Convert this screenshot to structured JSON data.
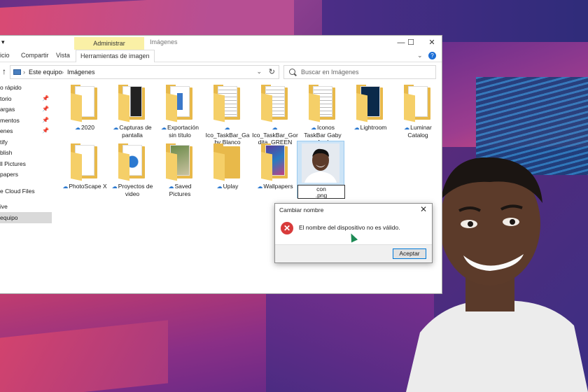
{
  "window": {
    "context_tab": "Administrar",
    "title": "Imágenes",
    "qa_arrow": "▾",
    "controls": [
      "—",
      "☐",
      "✕"
    ]
  },
  "ribbon": {
    "tabs": [
      "icio",
      "Compartir",
      "Vista",
      "Herramientas de imagen"
    ],
    "active_tab": "Herramientas de imagen",
    "expand": "⌄",
    "help": "?"
  },
  "address": {
    "up": "↑",
    "crumbs": [
      "Este equipo",
      "Imágenes"
    ],
    "separator": "›",
    "dropdown": "⌄",
    "refresh": "↻"
  },
  "search": {
    "placeholder": "Buscar en Imágenes",
    "icon": "search-icon"
  },
  "sidebar": {
    "items": [
      {
        "label": "o rápido",
        "pinned": false
      },
      {
        "label": "torio",
        "pinned": true
      },
      {
        "label": "argas",
        "pinned": true
      },
      {
        "label": "mentos",
        "pinned": true
      },
      {
        "label": "enes",
        "pinned": true
      },
      {
        "label": "tify",
        "pinned": false
      },
      {
        "label": "blish",
        "pinned": false
      },
      {
        "label": "ll Pictures",
        "pinned": false
      },
      {
        "label": "papers",
        "pinned": false
      },
      {
        "label": "e Cloud Files",
        "pinned": false
      },
      {
        "label": "ive",
        "pinned": false
      },
      {
        "label": "equipo",
        "pinned": false,
        "selected": true
      }
    ],
    "pin_glyph": "📌"
  },
  "files": [
    {
      "label": "2020",
      "content": "blank"
    },
    {
      "label": "Capturas de pantalla",
      "content": "dark"
    },
    {
      "label": "Exportación sin título",
      "content": "blue"
    },
    {
      "label": "Ico_TaskBar_Gaby Blanco",
      "content": "lines"
    },
    {
      "label": "Ico_TaskBar_Gordita_GREEN",
      "content": "lines"
    },
    {
      "label": "Iconos TaskBar Gaby Azul",
      "content": "lines"
    },
    {
      "label": "Lightroom",
      "content": "lr"
    },
    {
      "label": "Luminar Catalog",
      "content": "blank"
    },
    {
      "label": "PhotoScape X",
      "content": "blank"
    },
    {
      "label": "Proyectos de video",
      "content": "play"
    },
    {
      "label": "Saved Pictures",
      "content": "photo"
    },
    {
      "label": "Uplay",
      "content": "empty"
    },
    {
      "label": "Wallpapers",
      "content": "wall"
    }
  ],
  "cloud_glyph": "☁",
  "renaming_file": {
    "name_line1": "con",
    "name_line2": ".png"
  },
  "dialog": {
    "title": "Cambiar nombre",
    "close": "✕",
    "icon": "✕",
    "message": "El nombre del dispositivo no es válido.",
    "ok": "Aceptar"
  },
  "colors": {
    "folder": "#e8b94a",
    "selection": "#cce4f7",
    "error": "#d83b3b",
    "accent": "#0078d7",
    "context_tab": "#faf0a6"
  }
}
